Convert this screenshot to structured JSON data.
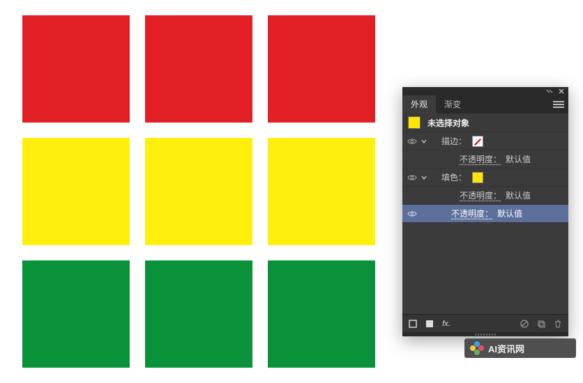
{
  "grid": {
    "rows": [
      {
        "color": "#E31F26",
        "name": "red"
      },
      {
        "color": "#FFEF0D",
        "name": "yellow"
      },
      {
        "color": "#0A923A",
        "name": "green"
      }
    ]
  },
  "panel": {
    "tabs": {
      "appearance": "外观",
      "gradient": "渐变"
    },
    "no_selection": "未选择对象",
    "stroke": {
      "label": "描边：",
      "swatch": "none"
    },
    "fill": {
      "label": "填色：",
      "swatch": "yellow"
    },
    "opacity_label": "不透明度：",
    "opacity_value": "默认值",
    "fx_label": "fx."
  },
  "watermark": {
    "text": "AI资讯网"
  }
}
